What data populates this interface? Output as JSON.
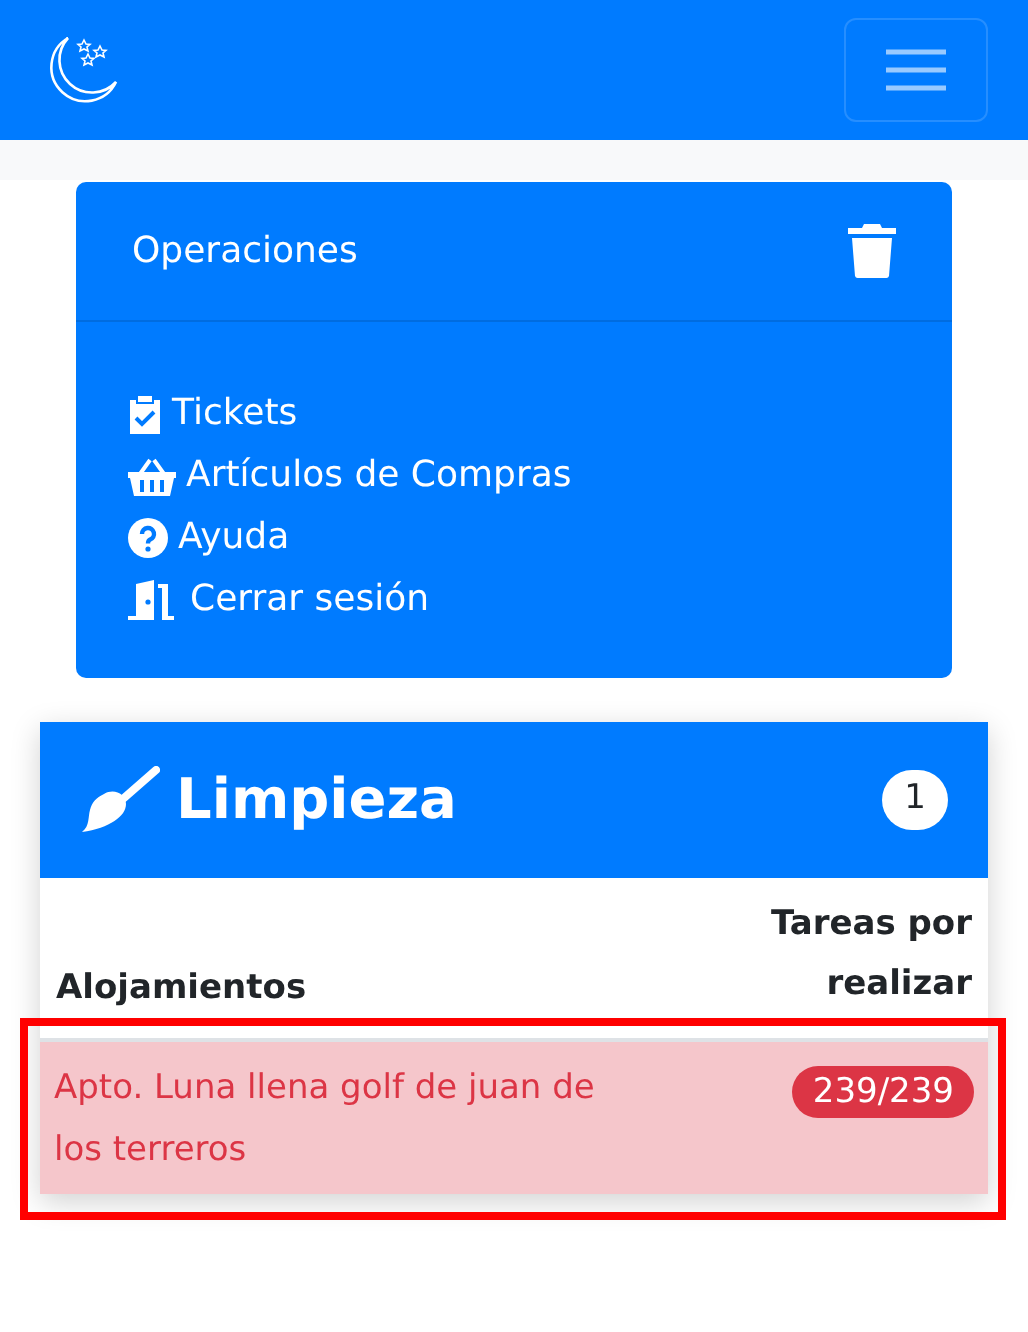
{
  "navbar": {
    "menu_expanded": false
  },
  "operations": {
    "title": "Operaciones",
    "items": [
      {
        "kind": "tickets",
        "label": "Tickets"
      },
      {
        "kind": "basket",
        "label": "Artículos de Compras"
      },
      {
        "kind": "help",
        "label": "Ayuda"
      },
      {
        "kind": "logout",
        "label": "Cerrar sesión"
      }
    ]
  },
  "cleaning": {
    "title": "Limpieza",
    "count": "1",
    "columns": [
      "Alojamientos",
      "Tareas por realizar"
    ],
    "rows": [
      {
        "name": "Apto. Luna llena golf de juan de los terreros",
        "tasks": "239/239",
        "highlighted": true
      }
    ]
  }
}
